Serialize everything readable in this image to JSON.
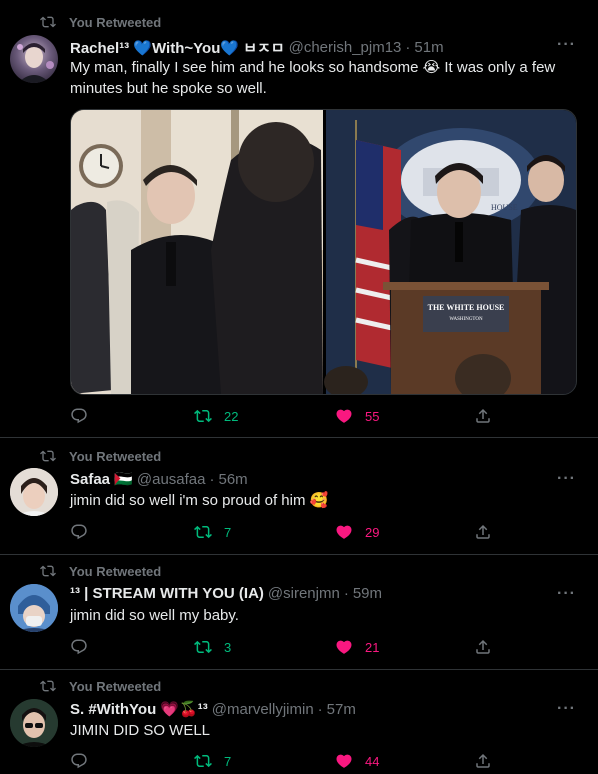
{
  "tweets": [
    {
      "retweet_label": "You Retweeted",
      "name": "Rachel¹³ 💙With~You💙 ㅂㅈㅁ",
      "handle": "@cherish_pjm13",
      "dot": "·",
      "time": "51m",
      "text": "My man, finally I see him and he looks so handsome 😭 It was only a few minutes but he spoke so well.",
      "reply_count": "",
      "retweet_count": "22",
      "like_count": "55",
      "photo_text": {
        "podium_line1": "THE WHITE HOUSE",
        "podium_line2": "WASHINGTON",
        "backdrop": "HOUSE"
      }
    },
    {
      "retweet_label": "You Retweeted",
      "name": "Safaa 🇵🇸",
      "handle": "@ausafaa",
      "dot": "·",
      "time": "56m",
      "text": "jimin did so well i'm so proud of him 🥰",
      "retweet_count": "7",
      "like_count": "29"
    },
    {
      "retweet_label": "You Retweeted",
      "name": "¹³ | STREAM WITH YOU (IA)",
      "handle": "@sirenjmn",
      "dot": "·",
      "time": "59m",
      "text": "jimin did so well my baby.",
      "retweet_count": "3",
      "like_count": "21"
    },
    {
      "retweet_label": "You Retweeted",
      "name": "S. #WithYou 💗🍒¹³",
      "handle": "@marvellyjimin",
      "dot": "·",
      "time": "57m",
      "text": "JIMIN DID SO WELL",
      "retweet_count": "7",
      "like_count": "44"
    }
  ],
  "icons": [
    "retweet-icon",
    "reply-icon",
    "heart-icon",
    "share-icon",
    "more-icon"
  ],
  "colors": {
    "retweet_active": "#00ba7c",
    "like_active": "#f91880",
    "muted": "#71767b",
    "text": "#e7e9ea",
    "divider": "#2f3336",
    "background": "#000000"
  }
}
